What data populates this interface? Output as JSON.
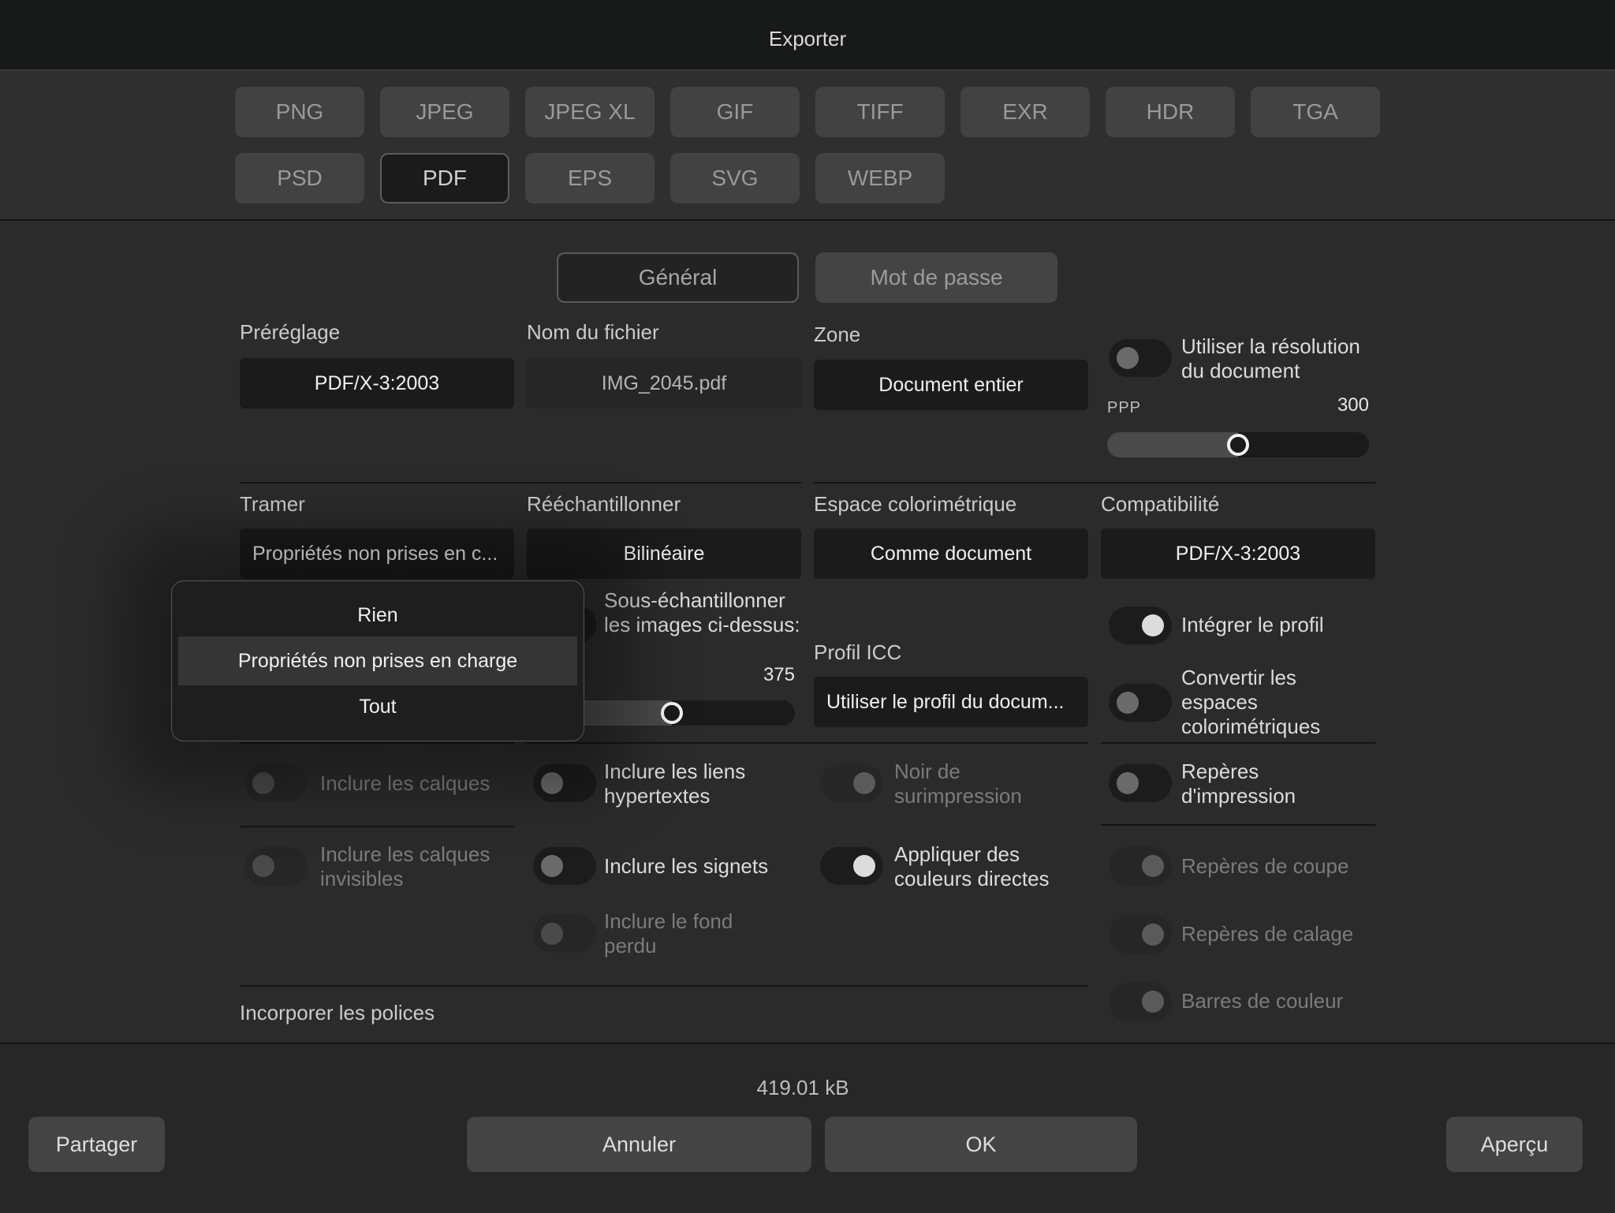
{
  "window": {
    "title": "Exporter"
  },
  "formats": {
    "row1": [
      "PNG",
      "JPEG",
      "JPEG XL",
      "GIF",
      "TIFF",
      "EXR",
      "HDR",
      "TGA"
    ],
    "row2": [
      "PSD",
      "PDF",
      "EPS",
      "SVG",
      "WEBP"
    ],
    "selected": "PDF"
  },
  "tabs": {
    "general": "Général",
    "password": "Mot de passe",
    "active": "Général"
  },
  "preset": {
    "label": "Préréglage",
    "value": "PDF/X-3:2003"
  },
  "filename": {
    "label": "Nom du fichier",
    "value": "IMG_2045.pdf"
  },
  "zone": {
    "label": "Zone",
    "value": "Document entier"
  },
  "resolution": {
    "toggle_label": "Utiliser la résolution du document",
    "toggle_on": false,
    "ppp_label": "PPP",
    "ppp_value": "300",
    "slider_fraction": 0.5
  },
  "tramer": {
    "label": "Tramer",
    "value": "Propriétés non prises en c..."
  },
  "resample": {
    "label": "Rééchantillonner",
    "value": "Bilinéaire"
  },
  "colorspace": {
    "label": "Espace colorimétrique",
    "value": "Comme document"
  },
  "compat": {
    "label": "Compatibilité",
    "value": "PDF/X-3:2003"
  },
  "subsample": {
    "label": "Sous-échantillonner les images ci-dessus:",
    "value": "375",
    "slider_fraction": 0.53
  },
  "icc": {
    "label": "Profil ICC",
    "value": "Utiliser le profil du docum..."
  },
  "embed_profile": {
    "label": "Intégrer le profil",
    "on": true
  },
  "convert_spaces": {
    "label": "Convertir les espaces colorimétriques",
    "on": false
  },
  "layers": {
    "label": "Inclure les calques",
    "on": false,
    "disabled": true
  },
  "hyperlinks": {
    "label": "Inclure les liens hypertextes",
    "on": false
  },
  "overprint": {
    "label": "Noir de surimpression",
    "on": true,
    "disabled": true
  },
  "print_marks": {
    "label": "Repères d'impression",
    "on": false
  },
  "invisible_layers": {
    "label": "Inclure les calques invisibles",
    "on": false,
    "disabled": true
  },
  "bookmarks": {
    "label": "Inclure les signets",
    "on": false
  },
  "spot_colors": {
    "label": "Appliquer des couleurs directes",
    "on": true
  },
  "crop_marks": {
    "label": "Repères de coupe",
    "on": true,
    "disabled": true
  },
  "bleed": {
    "label": "Inclure le fond perdu",
    "on": false,
    "disabled": true
  },
  "registration_marks": {
    "label": "Repères de calage",
    "on": true,
    "disabled": true
  },
  "color_bars": {
    "label": "Barres de couleur",
    "on": true,
    "disabled": true
  },
  "fonts": {
    "label": "Incorporer les polices"
  },
  "popup": {
    "items": [
      "Rien",
      "Propriétés non prises en charge",
      "Tout"
    ],
    "selected_index": 1
  },
  "footer": {
    "size": "419.01 kB",
    "share": "Partager",
    "cancel": "Annuler",
    "ok": "OK",
    "preview": "Aperçu"
  }
}
